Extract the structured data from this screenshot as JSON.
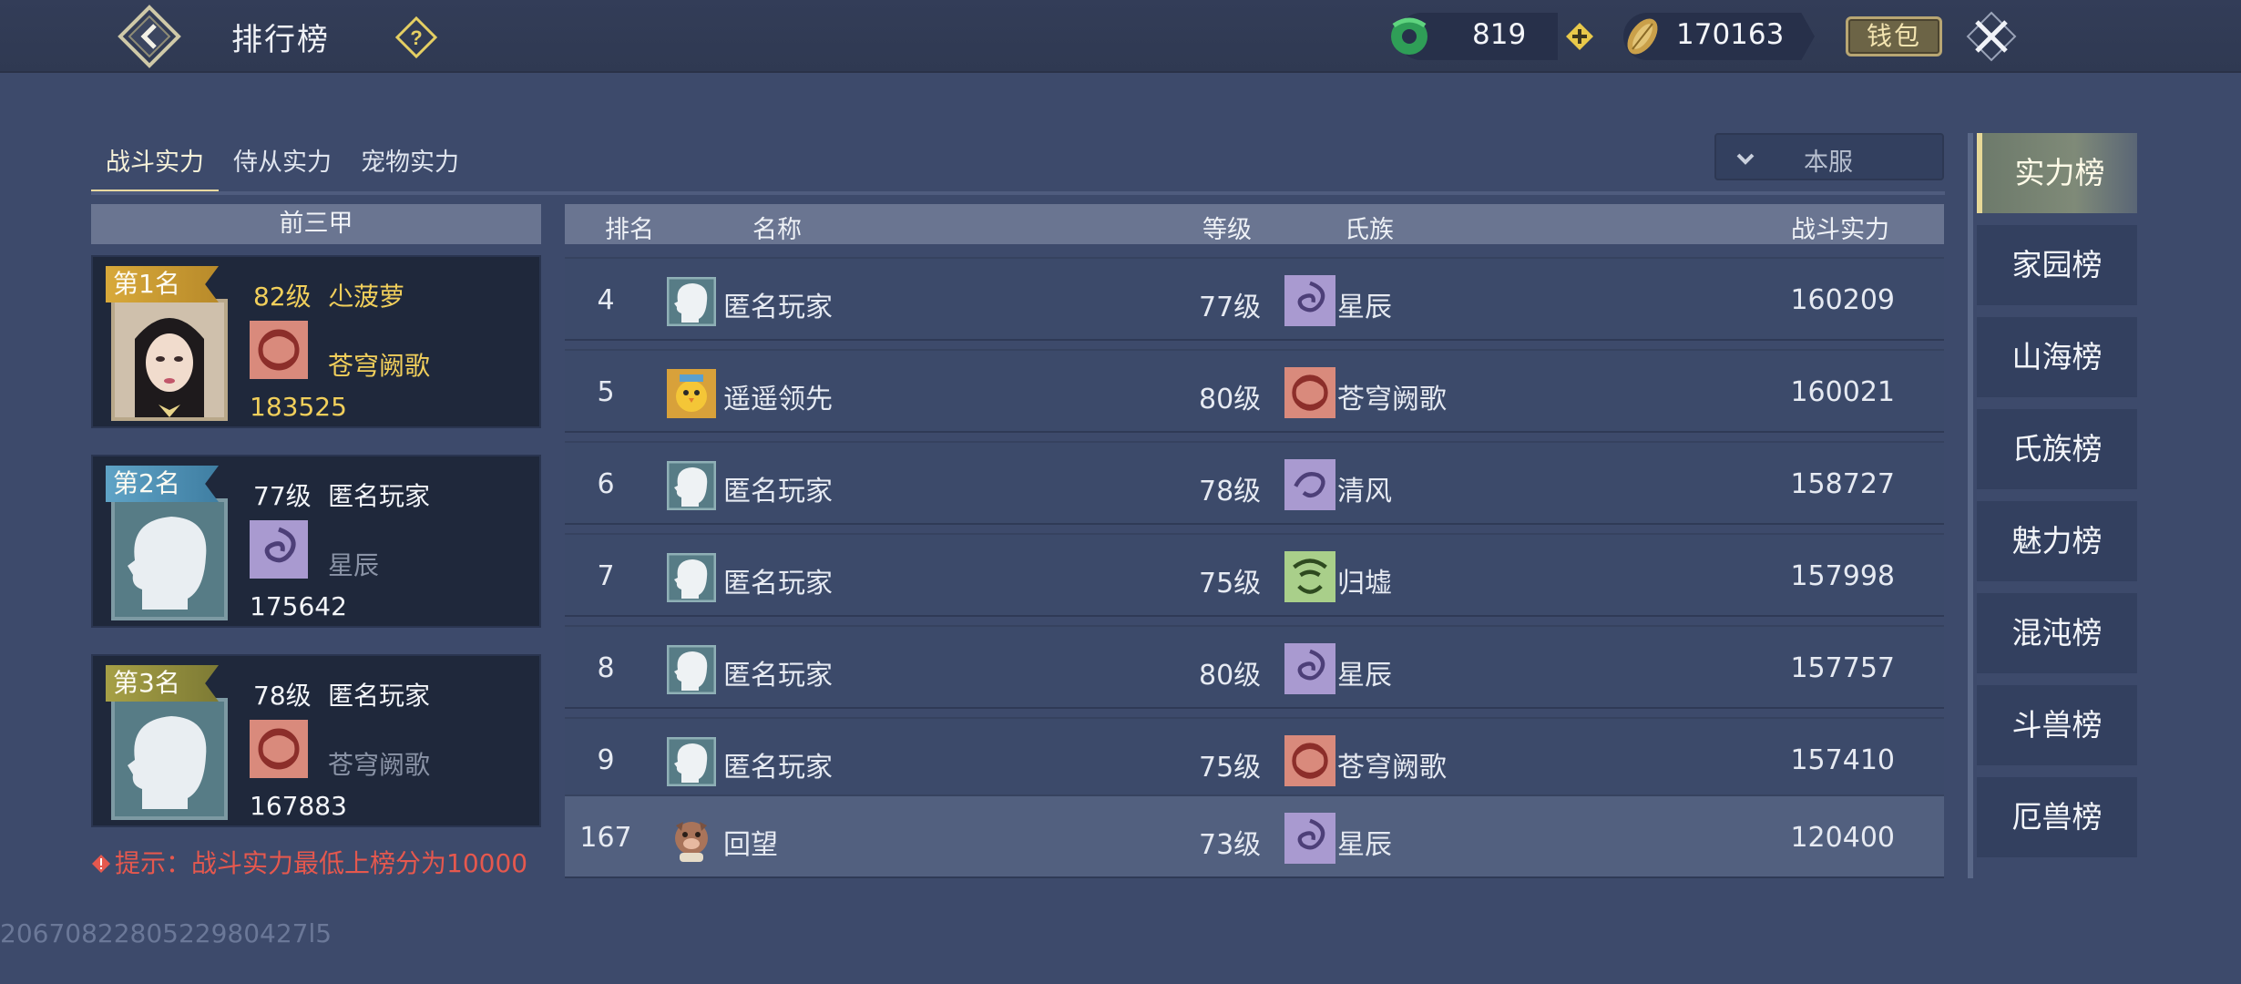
{
  "header": {
    "title": "排行榜",
    "jade_amount": "819",
    "gold_amount": "170163",
    "wallet_label": "钱包"
  },
  "tabs": [
    "战斗实力",
    "侍从实力",
    "宠物实力"
  ],
  "server_filter": "本服",
  "top3": {
    "header": "前三甲",
    "cards": [
      {
        "badge": "第1名",
        "level": "82级",
        "name": "尐菠萝",
        "clan": "苍穹阙歌",
        "power": "183525"
      },
      {
        "badge": "第2名",
        "level": "77级",
        "name": "匿名玩家",
        "clan": "星辰",
        "power": "175642"
      },
      {
        "badge": "第3名",
        "level": "78级",
        "name": "匿名玩家",
        "clan": "苍穹阙歌",
        "power": "167883"
      }
    ],
    "tip": "提示：战斗实力最低上榜分为10000"
  },
  "table": {
    "headers": {
      "rank": "排名",
      "name": "名称",
      "level": "等级",
      "clan": "氏族",
      "power": "战斗实力"
    },
    "rows": [
      {
        "rank": "4",
        "name": "匿名玩家",
        "level": "77级",
        "clan": "星辰",
        "power": "160209"
      },
      {
        "rank": "5",
        "name": "遥遥领先",
        "level": "80级",
        "clan": "苍穹阙歌",
        "power": "160021"
      },
      {
        "rank": "6",
        "name": "匿名玩家",
        "level": "78级",
        "clan": "清风",
        "power": "158727"
      },
      {
        "rank": "7",
        "name": "匿名玩家",
        "level": "75级",
        "clan": "归墟",
        "power": "157998"
      },
      {
        "rank": "8",
        "name": "匿名玩家",
        "level": "80级",
        "clan": "星辰",
        "power": "157757"
      },
      {
        "rank": "9",
        "name": "匿名玩家",
        "level": "75级",
        "clan": "苍穹阙歌",
        "power": "157410"
      }
    ],
    "self_row": {
      "rank": "167",
      "name": "回望",
      "level": "73级",
      "clan": "星辰",
      "power": "120400"
    }
  },
  "nav": [
    "实力榜",
    "家园榜",
    "山海榜",
    "氏族榜",
    "魅力榜",
    "混沌榜",
    "斗兽榜",
    "厄兽榜"
  ],
  "footer_id": "2067082280522980427l5",
  "colors": {
    "bg": "#3d4a6b",
    "gold_text": "#f1cf5b",
    "tip_red": "#e5584e",
    "nav_active_border": "#e7d897"
  }
}
